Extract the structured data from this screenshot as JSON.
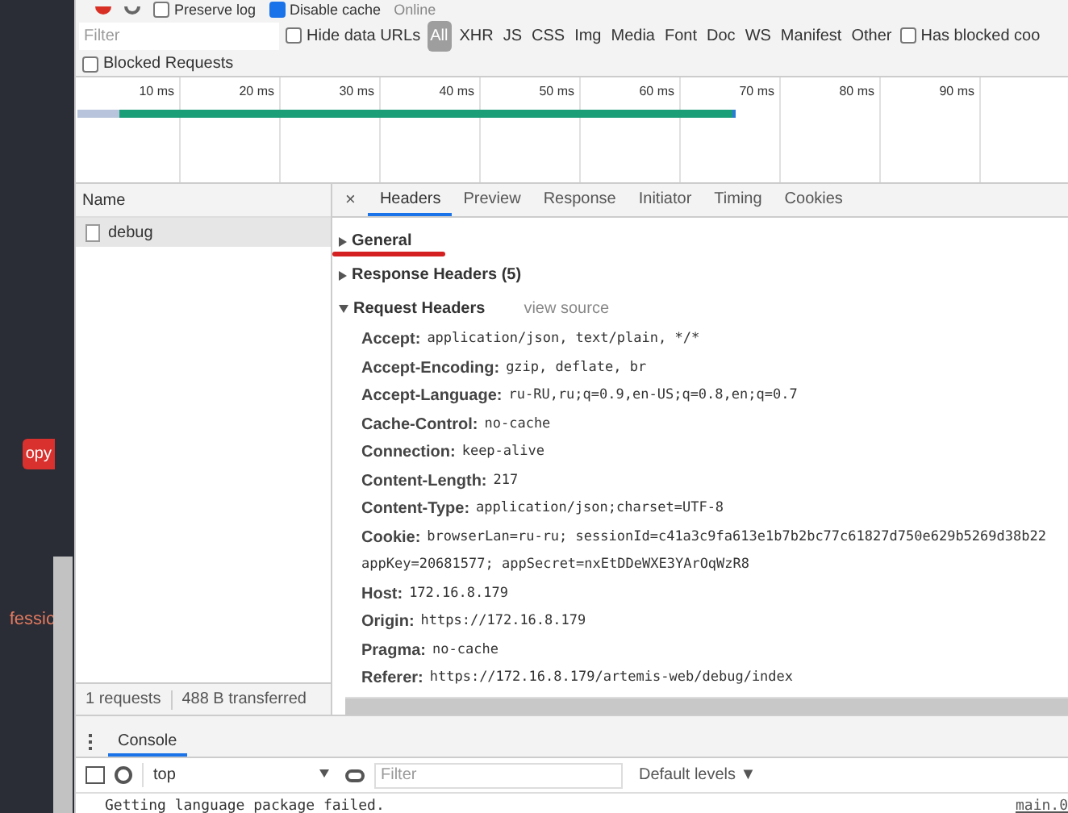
{
  "page_behind": {
    "button_text": "opy",
    "link_text": "fessic"
  },
  "toolbar": {
    "preserve_log": {
      "label": "Preserve log",
      "checked": false
    },
    "disable_cache": {
      "label": "Disable cache",
      "checked": true
    },
    "throttling": "Online"
  },
  "filter_bar": {
    "placeholder": "Filter",
    "hide_data_urls": {
      "label": "Hide data URLs",
      "checked": false
    },
    "types": [
      {
        "label": "All",
        "selected": true
      },
      {
        "label": "XHR",
        "selected": false
      },
      {
        "label": "JS",
        "selected": false
      },
      {
        "label": "CSS",
        "selected": false
      },
      {
        "label": "Img",
        "selected": false
      },
      {
        "label": "Media",
        "selected": false
      },
      {
        "label": "Font",
        "selected": false
      },
      {
        "label": "Doc",
        "selected": false
      },
      {
        "label": "WS",
        "selected": false
      },
      {
        "label": "Manifest",
        "selected": false
      },
      {
        "label": "Other",
        "selected": false
      }
    ],
    "has_blocked_cookies": {
      "label": "Has blocked coo",
      "checked": false
    },
    "blocked_requests": {
      "label": "Blocked Requests",
      "checked": false
    }
  },
  "timeline": {
    "ticks": [
      "10 ms",
      "20 ms",
      "30 ms",
      "40 ms",
      "50 ms",
      "60 ms",
      "70 ms",
      "80 ms",
      "90 ms"
    ]
  },
  "requests": {
    "column": "Name",
    "rows": [
      {
        "name": "debug",
        "selected": true
      }
    ],
    "summary": [
      "1 requests",
      "488 B transferred"
    ]
  },
  "details": {
    "close": "×",
    "tabs": [
      {
        "label": "Headers",
        "selected": true
      },
      {
        "label": "Preview",
        "selected": false
      },
      {
        "label": "Response",
        "selected": false
      },
      {
        "label": "Initiator",
        "selected": false
      },
      {
        "label": "Timing",
        "selected": false
      },
      {
        "label": "Cookies",
        "selected": false
      }
    ],
    "sections": [
      {
        "title": "General",
        "expanded": false,
        "underlined": true
      },
      {
        "title": "Response Headers (5)",
        "expanded": false,
        "underlined": false
      },
      {
        "title": "Request Headers",
        "expanded": true,
        "underlined": false,
        "link": "view source",
        "headers": [
          {
            "name": "Accept:",
            "value": "application/json, text/plain, */*"
          },
          {
            "name": "Accept-Encoding:",
            "value": "gzip, deflate, br"
          },
          {
            "name": "Accept-Language:",
            "value": "ru-RU,ru;q=0.9,en-US;q=0.8,en;q=0.7"
          },
          {
            "name": "Cache-Control:",
            "value": "no-cache"
          },
          {
            "name": "Connection:",
            "value": "keep-alive"
          },
          {
            "name": "Content-Length:",
            "value": "217"
          },
          {
            "name": "Content-Type:",
            "value": "application/json;charset=UTF-8"
          },
          {
            "name": "Cookie:",
            "value": "browserLan=ru-ru; sessionId=c41a3c9fa613e1b7b2bc77c61827d750e629b5269d38b22",
            "continuation": "appKey=20681577; appSecret=nxEtDDeWXE3YArOqWzR8"
          },
          {
            "name": "Host:",
            "value": "172.16.8.179"
          },
          {
            "name": "Origin:",
            "value": "https://172.16.8.179"
          },
          {
            "name": "Pragma:",
            "value": "no-cache"
          },
          {
            "name": "Referer:",
            "value": "https://172.16.8.179/artemis-web/debug/index"
          }
        ]
      }
    ]
  },
  "drawer": {
    "tab": "Console",
    "context": "top",
    "filter_placeholder": "Filter",
    "levels": "Default levels ▼",
    "messages": [
      {
        "text": "Getting language package failed.",
        "source": "main.0"
      }
    ]
  }
}
